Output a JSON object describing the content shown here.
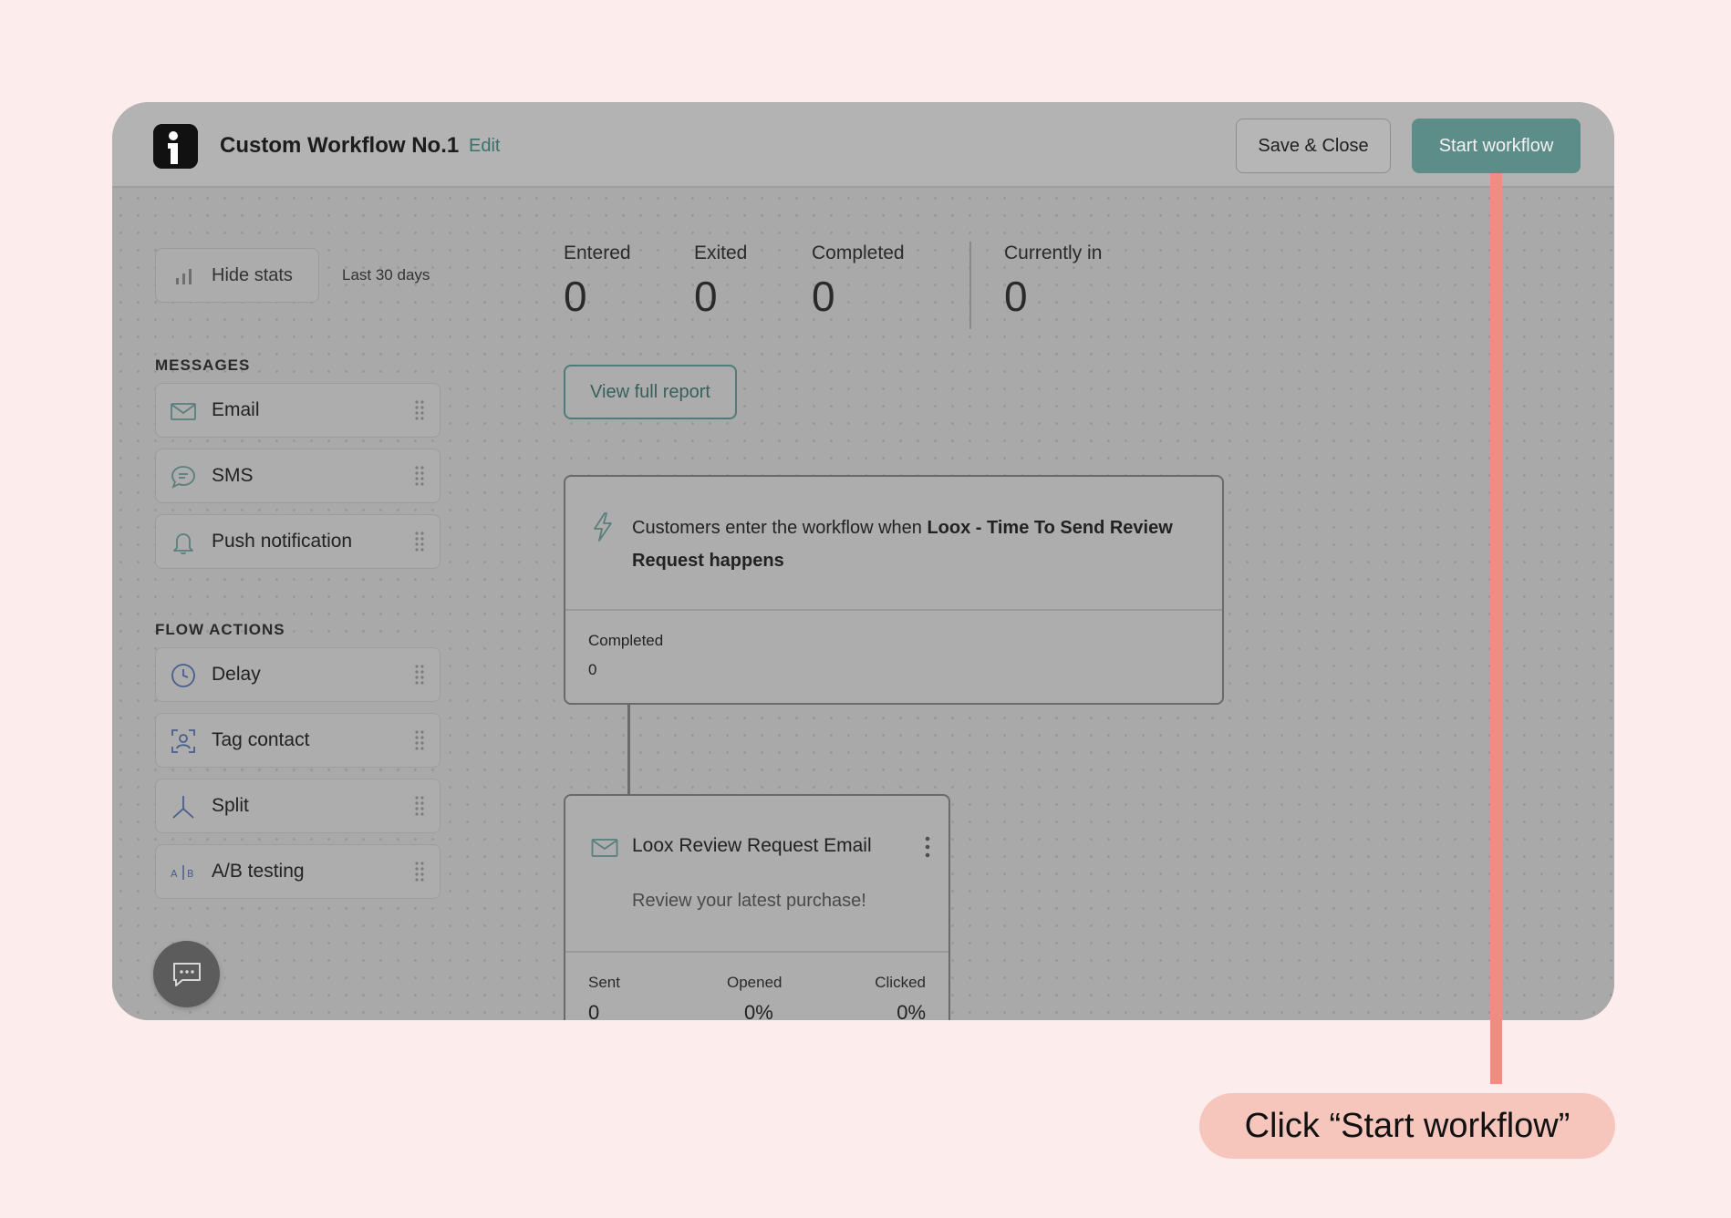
{
  "header": {
    "workflow_title": "Custom Workflow No.1",
    "edit_label": "Edit",
    "save_label": "Save & Close",
    "start_label": "Start workflow"
  },
  "sidebar": {
    "hide_stats_label": "Hide stats",
    "range_label": "Last 30 days",
    "messages_title": "MESSAGES",
    "messages": [
      {
        "label": "Email",
        "icon": "envelope-icon"
      },
      {
        "label": "SMS",
        "icon": "chat-bubble-icon"
      },
      {
        "label": "Push notification",
        "icon": "bell-icon"
      }
    ],
    "flow_actions_title": "FLOW ACTIONS",
    "flow_actions": [
      {
        "label": "Delay",
        "icon": "clock-icon"
      },
      {
        "label": "Tag contact",
        "icon": "tag-contact-icon"
      },
      {
        "label": "Split",
        "icon": "split-icon"
      },
      {
        "label": "A/B testing",
        "icon": "ab-testing-icon"
      }
    ]
  },
  "stats": {
    "entered": {
      "label": "Entered",
      "value": "0"
    },
    "exited": {
      "label": "Exited",
      "value": "0"
    },
    "completed": {
      "label": "Completed",
      "value": "0"
    },
    "currently_in": {
      "label": "Currently in",
      "value": "0"
    },
    "view_report_label": "View full report"
  },
  "trigger_node": {
    "text_prefix": "Customers enter the workflow when ",
    "trigger_name": "Loox - Time To Send Review Request happens",
    "completed_label": "Completed",
    "completed_value": "0"
  },
  "email_node": {
    "name": "Loox Review Request Email",
    "subject": "Review your latest purchase!",
    "sent_label": "Sent",
    "sent_value": "0",
    "opened_label": "Opened",
    "opened_value": "0%",
    "clicked_label": "Clicked",
    "clicked_value": "0%"
  },
  "callout": {
    "text": "Click “Start workflow”"
  },
  "colors": {
    "accent": "#5d8d88",
    "callout_line": "#ef8d80",
    "callout_bg": "#f6c6bd",
    "page_bg": "#fdecec"
  }
}
